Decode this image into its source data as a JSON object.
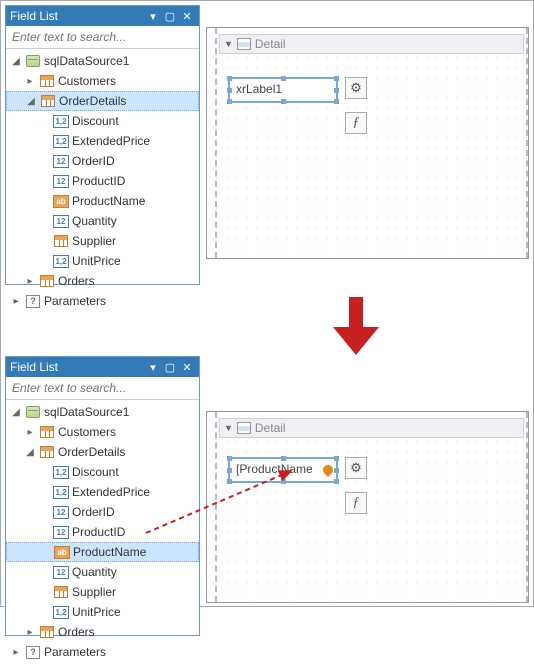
{
  "panel": {
    "title": "Field List",
    "search_placeholder": "Enter text to search..."
  },
  "tree": {
    "root": {
      "label": "sqlDataSource1"
    },
    "tables": {
      "customers": "Customers",
      "orderdetails": "OrderDetails",
      "orders": "Orders"
    },
    "fields": {
      "discount": "Discount",
      "extendedprice": "ExtendedPrice",
      "orderid": "OrderID",
      "productid": "ProductID",
      "productname": "ProductName",
      "quantity": "Quantity",
      "supplier": "Supplier",
      "unitprice": "UnitPrice"
    },
    "parameters": "Parameters"
  },
  "icons": {
    "num": "1,2",
    "int": "12",
    "str": "ab",
    "q": "?"
  },
  "designer": {
    "band": "Detail",
    "label_before": "xrLabel1",
    "label_after": "[ProductName"
  }
}
